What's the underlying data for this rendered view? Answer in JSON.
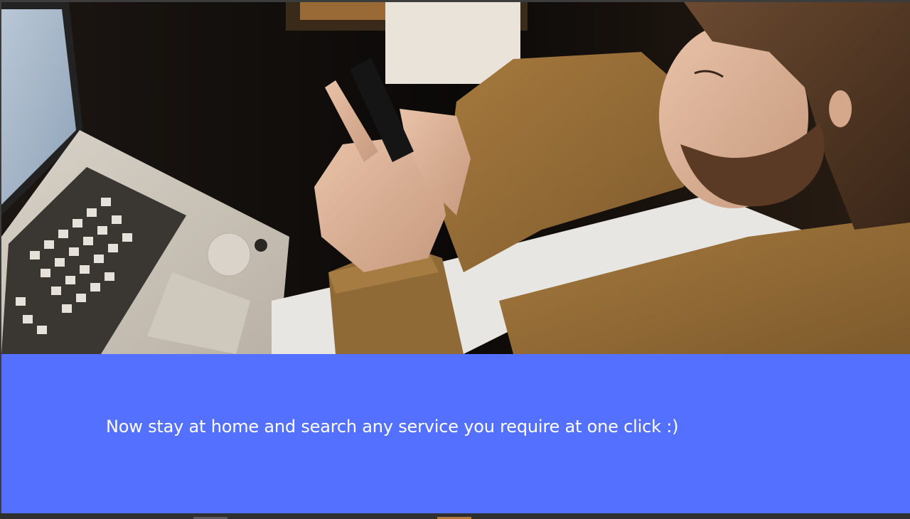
{
  "hero": {
    "image_description_name": "man-using-phone-photo"
  },
  "banner": {
    "text": "Now stay at home and search any service you require at one click :)",
    "background_color": "#5470fe",
    "text_color": "#ffffff"
  }
}
